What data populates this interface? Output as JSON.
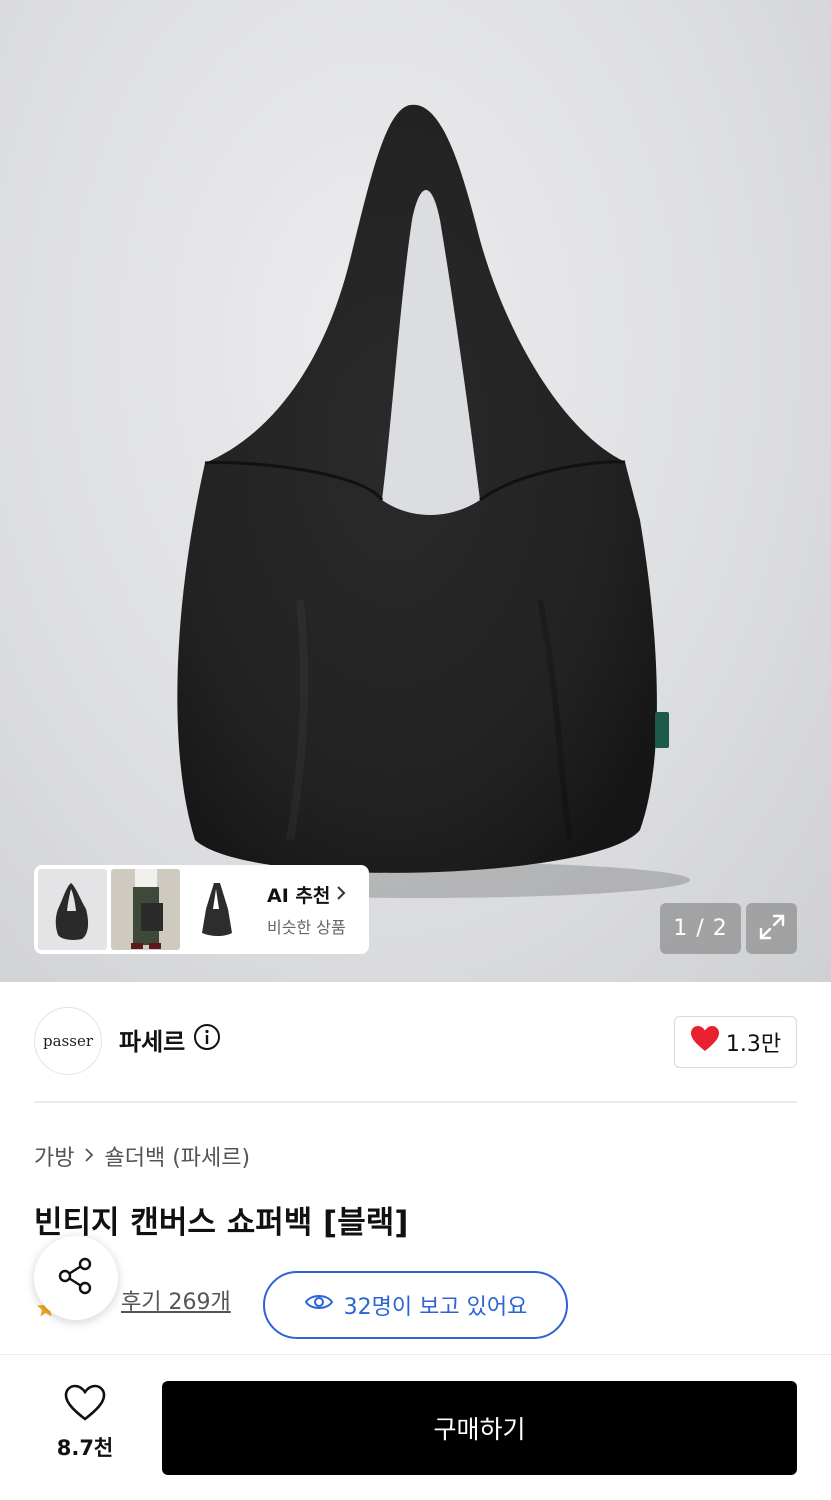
{
  "gallery": {
    "page_indicator": "1 / 2",
    "ai_recommend": {
      "title": "AI 추천",
      "subtitle": "비슷한 상품"
    }
  },
  "brand": {
    "logo_text": "passer",
    "name": "파세르",
    "like_count": "1.3만"
  },
  "product": {
    "breadcrumb": [
      "가방",
      "숄더백 (파세르)"
    ],
    "title": "빈티지 캔버스 쇼퍼백 [블랙]",
    "review_label": "후기 269개",
    "viewers_label": "32명이 보고 있어요"
  },
  "bottom_bar": {
    "wish_count": "8.7천",
    "buy_label": "구매하기"
  },
  "colors": {
    "accent_blue": "#2c63d6",
    "heart_red": "#e8202f",
    "buy_button": "#000000",
    "star_orange": "#f5a623"
  },
  "icons": [
    "info-icon",
    "heart-icon",
    "chevron-right-icon",
    "expand-icon",
    "share-icon",
    "eye-icon",
    "star-icon",
    "heart-outline-icon"
  ]
}
